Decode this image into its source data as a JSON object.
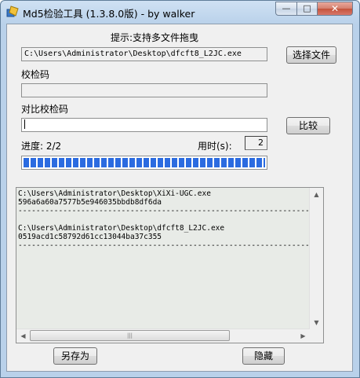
{
  "window": {
    "title": "Md5检验工具 (1.3.8.0版) - by walker",
    "controls": {
      "minimize": "—",
      "maximize": "□",
      "close": "✕"
    }
  },
  "hint": "提示:支持多文件拖曳",
  "file_path": "C:\\Users\\Administrator\\Desktop\\dfcft8_L2JC.exe",
  "select_file_button": "选择文件",
  "checksum_label": "校检码",
  "checksum_value": "",
  "compare_label": "对比校检码",
  "compare_value": "",
  "compare_button": "比较",
  "progress_label": "进度: 2/2",
  "progress_fraction": 1.0,
  "time_label": "用时(s):",
  "time_value": "2",
  "log": {
    "entries": [
      {
        "path": "C:\\Users\\Administrator\\Desktop\\XiXi-UGC.exe",
        "md5": "596a6a60a7577b5e946035bbdb8df6da"
      },
      {
        "path": "C:\\Users\\Administrator\\Desktop\\dfcft8_L2JC.exe",
        "md5": "0519acd1c58792d61cc13044ba37c355"
      }
    ],
    "divider": "-----------------------------------------------------------------"
  },
  "save_as_button": "另存为",
  "hide_button": "隐藏"
}
